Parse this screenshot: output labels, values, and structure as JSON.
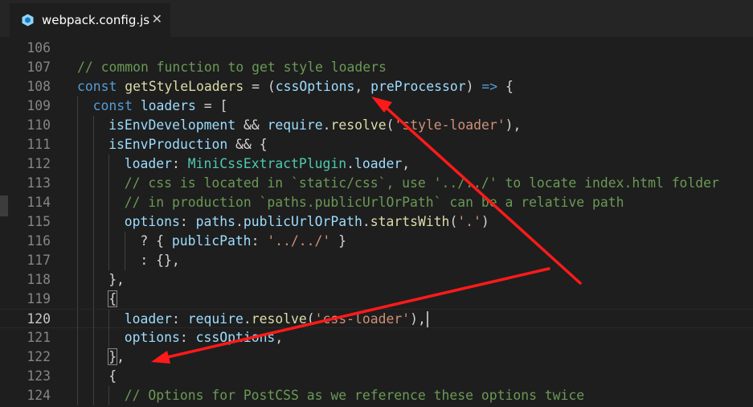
{
  "tab": {
    "filename": "webpack.config.js",
    "close_glyph": "✕",
    "icon": "webpack-cube-icon",
    "icon_color": "#8ed6fb"
  },
  "editor": {
    "active_line": 120,
    "lines": [
      {
        "num": "106",
        "indent": 0,
        "tokens": []
      },
      {
        "num": "107",
        "indent": 0,
        "tokens": [
          {
            "t": "com",
            "v": "// common function to get style loaders"
          }
        ]
      },
      {
        "num": "108",
        "indent": 0,
        "tokens": [
          {
            "t": "kw",
            "v": "const"
          },
          {
            "t": "pun",
            "v": " "
          },
          {
            "t": "fn",
            "v": "getStyleLoaders"
          },
          {
            "t": "pun",
            "v": " = ("
          },
          {
            "t": "var",
            "v": "cssOptions"
          },
          {
            "t": "pun",
            "v": ", "
          },
          {
            "t": "var",
            "v": "preProcessor"
          },
          {
            "t": "pun",
            "v": ") "
          },
          {
            "t": "kw",
            "v": "=>"
          },
          {
            "t": "pun",
            "v": " {"
          }
        ]
      },
      {
        "num": "109",
        "indent": 1,
        "tokens": [
          {
            "t": "kw",
            "v": "const"
          },
          {
            "t": "pun",
            "v": " "
          },
          {
            "t": "var",
            "v": "loaders"
          },
          {
            "t": "pun",
            "v": " = ["
          }
        ]
      },
      {
        "num": "110",
        "indent": 2,
        "tokens": [
          {
            "t": "var",
            "v": "isEnvDevelopment"
          },
          {
            "t": "pun",
            "v": " && "
          },
          {
            "t": "var",
            "v": "require"
          },
          {
            "t": "pun",
            "v": "."
          },
          {
            "t": "fn",
            "v": "resolve"
          },
          {
            "t": "pun",
            "v": "("
          },
          {
            "t": "str",
            "v": "'style-loader'"
          },
          {
            "t": "pun",
            "v": "),"
          }
        ]
      },
      {
        "num": "111",
        "indent": 2,
        "tokens": [
          {
            "t": "var",
            "v": "isEnvProduction"
          },
          {
            "t": "pun",
            "v": " && {"
          }
        ]
      },
      {
        "num": "112",
        "indent": 3,
        "tokens": [
          {
            "t": "var",
            "v": "loader"
          },
          {
            "t": "pun",
            "v": ": "
          },
          {
            "t": "cls",
            "v": "MiniCssExtractPlugin"
          },
          {
            "t": "pun",
            "v": "."
          },
          {
            "t": "var",
            "v": "loader"
          },
          {
            "t": "pun",
            "v": ","
          }
        ]
      },
      {
        "num": "113",
        "indent": 3,
        "tokens": [
          {
            "t": "com",
            "v": "// css is located in `static/css`, use '../../' to locate index.html folder"
          }
        ]
      },
      {
        "num": "114",
        "indent": 3,
        "tokens": [
          {
            "t": "com",
            "v": "// in production `paths.publicUrlOrPath` can be a relative path"
          }
        ]
      },
      {
        "num": "115",
        "indent": 3,
        "tokens": [
          {
            "t": "var",
            "v": "options"
          },
          {
            "t": "pun",
            "v": ": "
          },
          {
            "t": "var",
            "v": "paths"
          },
          {
            "t": "pun",
            "v": "."
          },
          {
            "t": "var",
            "v": "publicUrlOrPath"
          },
          {
            "t": "pun",
            "v": "."
          },
          {
            "t": "fn",
            "v": "startsWith"
          },
          {
            "t": "pun",
            "v": "("
          },
          {
            "t": "str",
            "v": "'.'"
          },
          {
            "t": "pun",
            "v": ")"
          }
        ]
      },
      {
        "num": "116",
        "indent": 4,
        "tokens": [
          {
            "t": "pun",
            "v": "? { "
          },
          {
            "t": "var",
            "v": "publicPath"
          },
          {
            "t": "pun",
            "v": ": "
          },
          {
            "t": "str",
            "v": "'../../'"
          },
          {
            "t": "pun",
            "v": " }"
          }
        ]
      },
      {
        "num": "117",
        "indent": 4,
        "tokens": [
          {
            "t": "pun",
            "v": ": {},"
          }
        ]
      },
      {
        "num": "118",
        "indent": 2,
        "tokens": [
          {
            "t": "pun",
            "v": "},"
          }
        ]
      },
      {
        "num": "119",
        "indent": 2,
        "tokens": [
          {
            "t": "pun",
            "v": "{",
            "hl": true
          }
        ]
      },
      {
        "num": "120",
        "indent": 3,
        "tokens": [
          {
            "t": "var",
            "v": "loader"
          },
          {
            "t": "pun",
            "v": ": "
          },
          {
            "t": "var",
            "v": "require"
          },
          {
            "t": "pun",
            "v": "."
          },
          {
            "t": "fn",
            "v": "resolve"
          },
          {
            "t": "pun",
            "v": "("
          },
          {
            "t": "str",
            "v": "'css-loader'"
          },
          {
            "t": "pun",
            "v": "),"
          }
        ]
      },
      {
        "num": "121",
        "indent": 3,
        "tokens": [
          {
            "t": "var",
            "v": "options"
          },
          {
            "t": "pun",
            "v": ": "
          },
          {
            "t": "var",
            "v": "cssOptions"
          },
          {
            "t": "pun",
            "v": ","
          }
        ]
      },
      {
        "num": "122",
        "indent": 2,
        "tokens": [
          {
            "t": "pun",
            "v": "}",
            "hl": true
          },
          {
            "t": "pun",
            "v": ","
          }
        ]
      },
      {
        "num": "123",
        "indent": 2,
        "tokens": [
          {
            "t": "pun",
            "v": "{"
          }
        ]
      },
      {
        "num": "124",
        "indent": 3,
        "tokens": [
          {
            "t": "com",
            "v": "// Options for PostCSS as we reference these options twice"
          }
        ]
      }
    ]
  },
  "annotations": {
    "arrow_color": "#ff1a1a"
  }
}
